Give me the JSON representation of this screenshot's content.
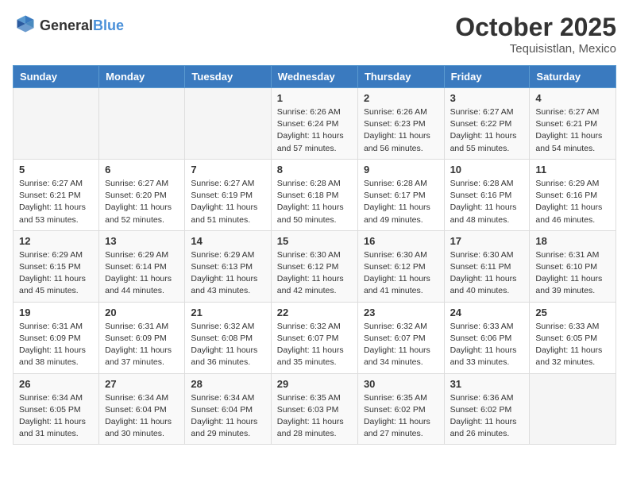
{
  "header": {
    "logo_general": "General",
    "logo_blue": "Blue",
    "month": "October 2025",
    "location": "Tequisistlan, Mexico"
  },
  "weekdays": [
    "Sunday",
    "Monday",
    "Tuesday",
    "Wednesday",
    "Thursday",
    "Friday",
    "Saturday"
  ],
  "weeks": [
    [
      {
        "day": "",
        "info": ""
      },
      {
        "day": "",
        "info": ""
      },
      {
        "day": "",
        "info": ""
      },
      {
        "day": "1",
        "info": "Sunrise: 6:26 AM\nSunset: 6:24 PM\nDaylight: 11 hours\nand 57 minutes."
      },
      {
        "day": "2",
        "info": "Sunrise: 6:26 AM\nSunset: 6:23 PM\nDaylight: 11 hours\nand 56 minutes."
      },
      {
        "day": "3",
        "info": "Sunrise: 6:27 AM\nSunset: 6:22 PM\nDaylight: 11 hours\nand 55 minutes."
      },
      {
        "day": "4",
        "info": "Sunrise: 6:27 AM\nSunset: 6:21 PM\nDaylight: 11 hours\nand 54 minutes."
      }
    ],
    [
      {
        "day": "5",
        "info": "Sunrise: 6:27 AM\nSunset: 6:21 PM\nDaylight: 11 hours\nand 53 minutes."
      },
      {
        "day": "6",
        "info": "Sunrise: 6:27 AM\nSunset: 6:20 PM\nDaylight: 11 hours\nand 52 minutes."
      },
      {
        "day": "7",
        "info": "Sunrise: 6:27 AM\nSunset: 6:19 PM\nDaylight: 11 hours\nand 51 minutes."
      },
      {
        "day": "8",
        "info": "Sunrise: 6:28 AM\nSunset: 6:18 PM\nDaylight: 11 hours\nand 50 minutes."
      },
      {
        "day": "9",
        "info": "Sunrise: 6:28 AM\nSunset: 6:17 PM\nDaylight: 11 hours\nand 49 minutes."
      },
      {
        "day": "10",
        "info": "Sunrise: 6:28 AM\nSunset: 6:16 PM\nDaylight: 11 hours\nand 48 minutes."
      },
      {
        "day": "11",
        "info": "Sunrise: 6:29 AM\nSunset: 6:16 PM\nDaylight: 11 hours\nand 46 minutes."
      }
    ],
    [
      {
        "day": "12",
        "info": "Sunrise: 6:29 AM\nSunset: 6:15 PM\nDaylight: 11 hours\nand 45 minutes."
      },
      {
        "day": "13",
        "info": "Sunrise: 6:29 AM\nSunset: 6:14 PM\nDaylight: 11 hours\nand 44 minutes."
      },
      {
        "day": "14",
        "info": "Sunrise: 6:29 AM\nSunset: 6:13 PM\nDaylight: 11 hours\nand 43 minutes."
      },
      {
        "day": "15",
        "info": "Sunrise: 6:30 AM\nSunset: 6:12 PM\nDaylight: 11 hours\nand 42 minutes."
      },
      {
        "day": "16",
        "info": "Sunrise: 6:30 AM\nSunset: 6:12 PM\nDaylight: 11 hours\nand 41 minutes."
      },
      {
        "day": "17",
        "info": "Sunrise: 6:30 AM\nSunset: 6:11 PM\nDaylight: 11 hours\nand 40 minutes."
      },
      {
        "day": "18",
        "info": "Sunrise: 6:31 AM\nSunset: 6:10 PM\nDaylight: 11 hours\nand 39 minutes."
      }
    ],
    [
      {
        "day": "19",
        "info": "Sunrise: 6:31 AM\nSunset: 6:09 PM\nDaylight: 11 hours\nand 38 minutes."
      },
      {
        "day": "20",
        "info": "Sunrise: 6:31 AM\nSunset: 6:09 PM\nDaylight: 11 hours\nand 37 minutes."
      },
      {
        "day": "21",
        "info": "Sunrise: 6:32 AM\nSunset: 6:08 PM\nDaylight: 11 hours\nand 36 minutes."
      },
      {
        "day": "22",
        "info": "Sunrise: 6:32 AM\nSunset: 6:07 PM\nDaylight: 11 hours\nand 35 minutes."
      },
      {
        "day": "23",
        "info": "Sunrise: 6:32 AM\nSunset: 6:07 PM\nDaylight: 11 hours\nand 34 minutes."
      },
      {
        "day": "24",
        "info": "Sunrise: 6:33 AM\nSunset: 6:06 PM\nDaylight: 11 hours\nand 33 minutes."
      },
      {
        "day": "25",
        "info": "Sunrise: 6:33 AM\nSunset: 6:05 PM\nDaylight: 11 hours\nand 32 minutes."
      }
    ],
    [
      {
        "day": "26",
        "info": "Sunrise: 6:34 AM\nSunset: 6:05 PM\nDaylight: 11 hours\nand 31 minutes."
      },
      {
        "day": "27",
        "info": "Sunrise: 6:34 AM\nSunset: 6:04 PM\nDaylight: 11 hours\nand 30 minutes."
      },
      {
        "day": "28",
        "info": "Sunrise: 6:34 AM\nSunset: 6:04 PM\nDaylight: 11 hours\nand 29 minutes."
      },
      {
        "day": "29",
        "info": "Sunrise: 6:35 AM\nSunset: 6:03 PM\nDaylight: 11 hours\nand 28 minutes."
      },
      {
        "day": "30",
        "info": "Sunrise: 6:35 AM\nSunset: 6:02 PM\nDaylight: 11 hours\nand 27 minutes."
      },
      {
        "day": "31",
        "info": "Sunrise: 6:36 AM\nSunset: 6:02 PM\nDaylight: 11 hours\nand 26 minutes."
      },
      {
        "day": "",
        "info": ""
      }
    ]
  ]
}
